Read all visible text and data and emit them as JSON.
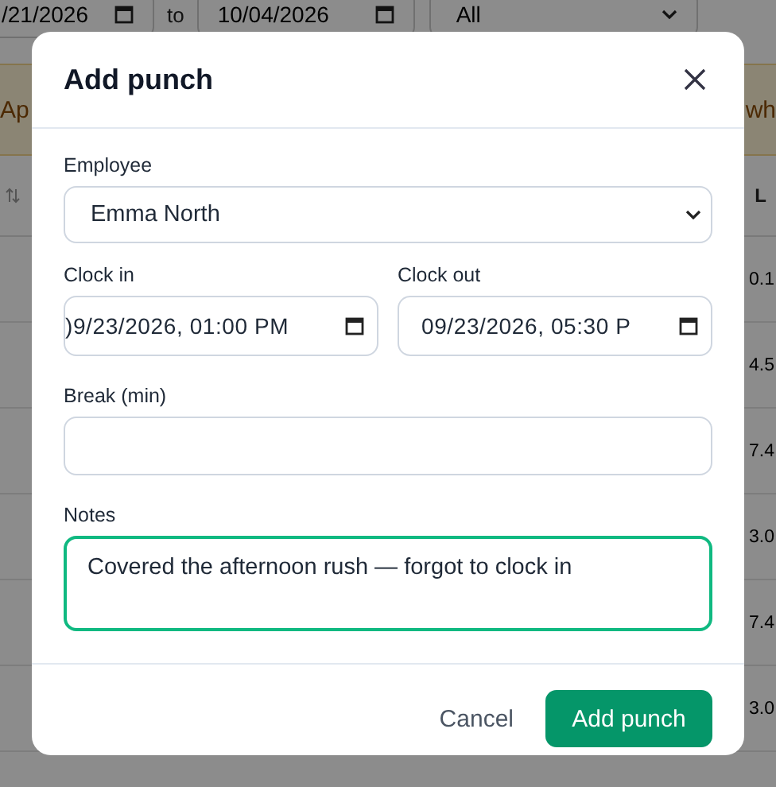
{
  "filters": {
    "date_from": "/21/2026",
    "to_label": "to",
    "date_to": "10/04/2026",
    "status": "All"
  },
  "banner": {
    "text_left": "Ap",
    "text_right": "wh"
  },
  "table": {
    "column_header": "L",
    "values": [
      "0.1",
      "4.5",
      "7.4",
      "3.0",
      "7.4",
      "3.0"
    ]
  },
  "dialog": {
    "title": "Add punch",
    "employee": {
      "label": "Employee",
      "value": "Emma North"
    },
    "clock_in": {
      "label": "Clock in",
      "value": ")9/23/2026, 01:00 PM"
    },
    "clock_out": {
      "label": "Clock out",
      "value": "09/23/2026, 05:30 P"
    },
    "break": {
      "label": "Break (min)"
    },
    "notes": {
      "label": "Notes",
      "value": "Covered the afternoon rush — forgot to clock in"
    },
    "buttons": {
      "cancel": "Cancel",
      "submit": "Add punch"
    }
  }
}
